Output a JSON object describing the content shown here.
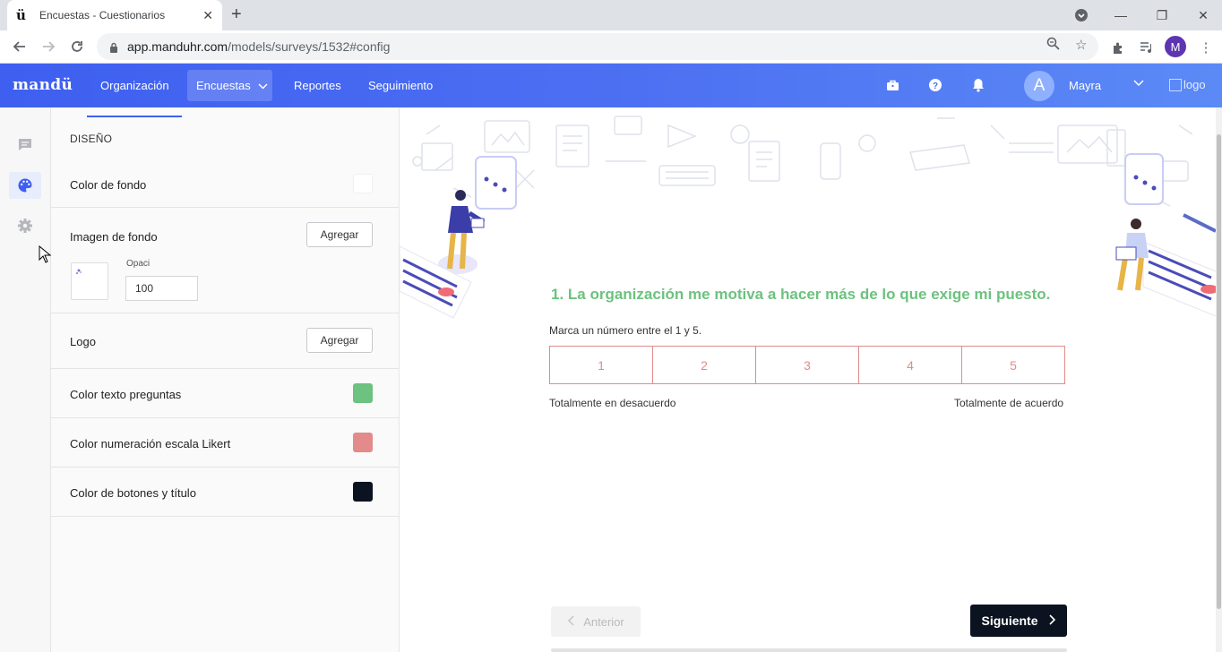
{
  "browser": {
    "tab_title": "Encuestas - Cuestionarios",
    "tab_favicon": "ü",
    "url_host": "app.manduhr.com",
    "url_path": "/models/surveys/1532#config",
    "profile_initial": "M"
  },
  "nav": {
    "brand": "mandü",
    "items": [
      {
        "label": "Organización"
      },
      {
        "label": "Encuestas"
      },
      {
        "label": "Reportes"
      },
      {
        "label": "Seguimiento"
      }
    ],
    "user_initial": "A",
    "user_name": "Mayra",
    "logo_alt": "logo"
  },
  "panel": {
    "section_title": "DISEÑO",
    "background_color_label": "Color de fondo",
    "background_image_label": "Imagen de fondo",
    "add_label": "Agregar",
    "opacity_label": "Opaci",
    "opacity_value": "100",
    "logo_label": "Logo",
    "question_color_label": "Color texto preguntas",
    "likert_color_label": "Color numeración escala Likert",
    "button_color_label": "Color de botones y título",
    "colors": {
      "background": "#ffffff",
      "question_text": "#6cc27e",
      "likert": "#e38a8a",
      "buttons": "#0b1320"
    }
  },
  "preview": {
    "question": "1. La organización me motiva a hacer más de lo que exige mi puesto.",
    "hint": "Marca un número entre el 1 y 5.",
    "options": [
      "1",
      "2",
      "3",
      "4",
      "5"
    ],
    "scale_min_label": "Totalmente en desacuerdo",
    "scale_max_label": "Totalmente de acuerdo",
    "prev_label": "Anterior",
    "next_label": "Siguiente"
  }
}
